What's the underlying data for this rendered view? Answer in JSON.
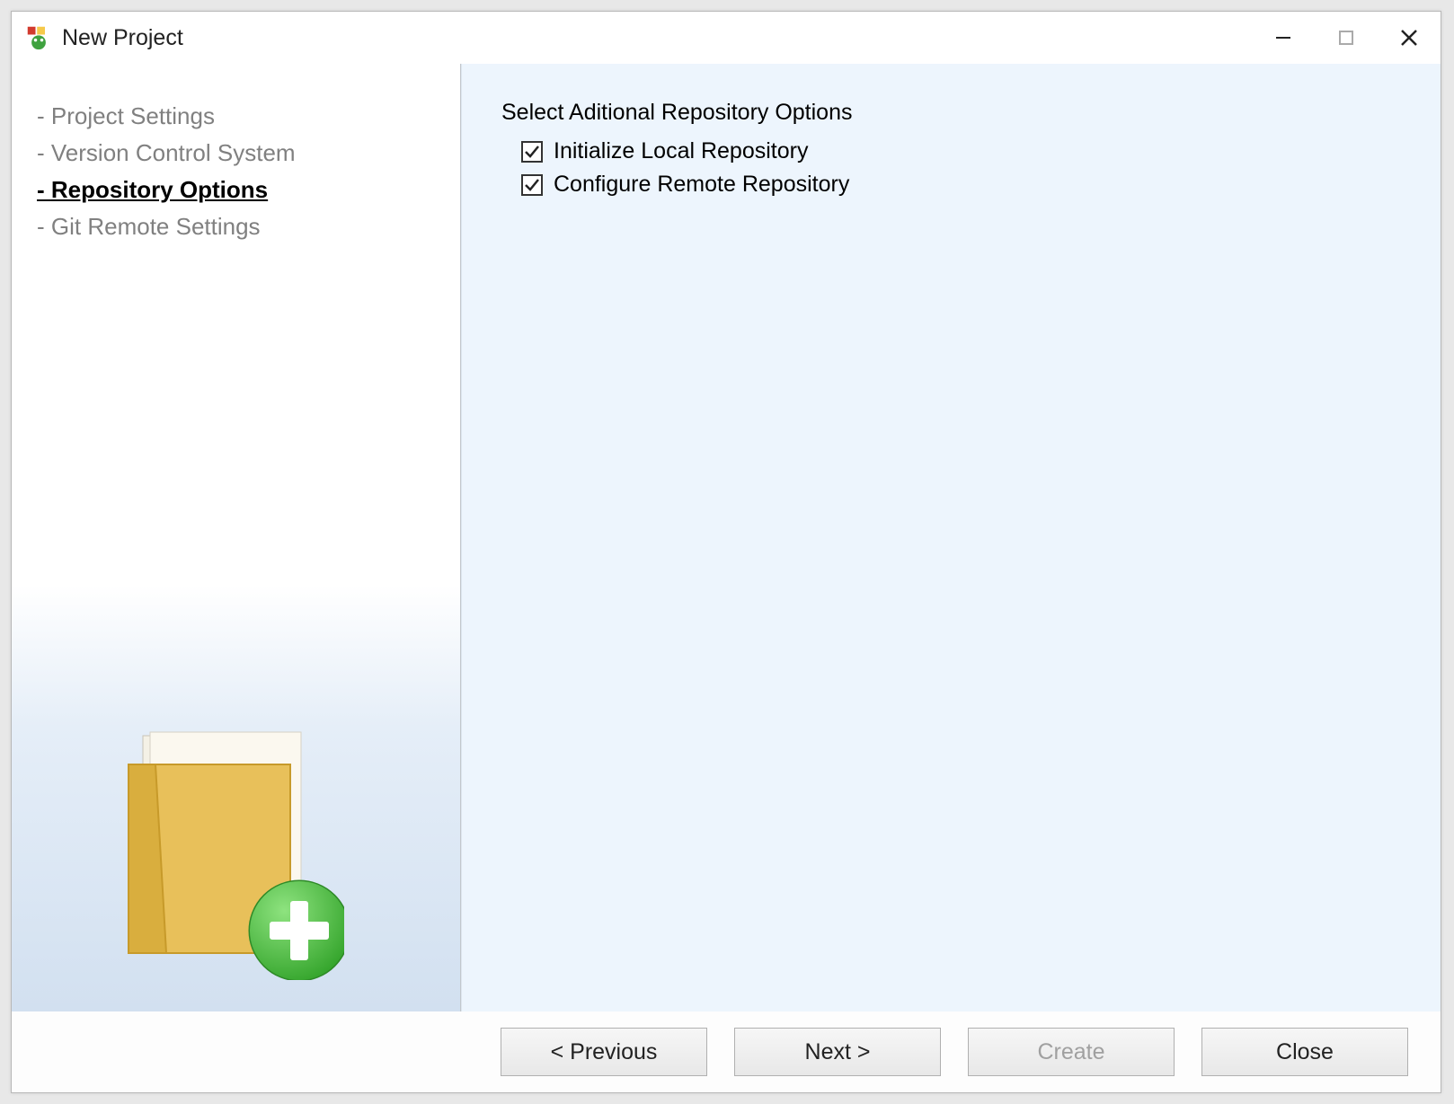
{
  "window": {
    "title": "New Project"
  },
  "nav": {
    "items": [
      {
        "label": "Project Settings",
        "active": false
      },
      {
        "label": "Version Control System",
        "active": false
      },
      {
        "label": "Repository Options",
        "active": true
      },
      {
        "label": "Git Remote Settings",
        "active": false
      }
    ]
  },
  "main": {
    "heading": "Select Aditional Repository Options",
    "options": [
      {
        "label": "Initialize Local Repository",
        "checked": true
      },
      {
        "label": "Configure Remote Repository",
        "checked": true
      }
    ]
  },
  "footer": {
    "previous": "< Previous",
    "next": "Next >",
    "create": "Create",
    "close": "Close",
    "create_enabled": false
  }
}
